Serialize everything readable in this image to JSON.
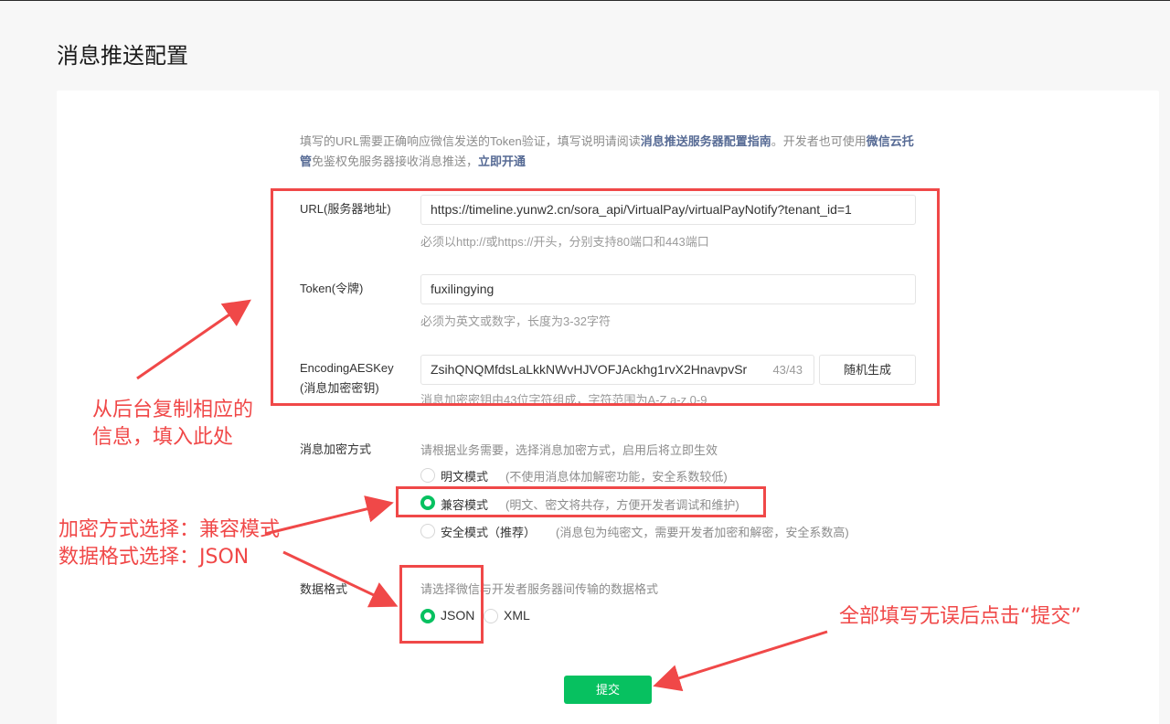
{
  "page_title": "消息推送配置",
  "intro": {
    "text1": "填写的URL需要正确响应微信发送的Token验证，填写说明请阅读",
    "link1": "消息推送服务器配置指南",
    "text2": "。开发者也可使用",
    "link2": "微信云托管",
    "text3": "免鉴权免服务器接收消息推送，",
    "link3": "立即开通"
  },
  "url_field": {
    "label": "URL(服务器地址)",
    "value": "https://timeline.yunw2.cn/sora_api/VirtualPay/virtualPayNotify?tenant_id=1",
    "help": "必须以http://或https://开头，分别支持80端口和443端口"
  },
  "token_field": {
    "label": "Token(令牌)",
    "value": "fuxilingying",
    "help": "必须为英文或数字，长度为3-32字符"
  },
  "aes_field": {
    "label_line1": "EncodingAESKey",
    "label_line2": "(消息加密密钥)",
    "value": "ZsihQNQMfdsLaLkkNWvHJVOFJAckhg1rvX2HnavpvSr",
    "counter": "43/43",
    "generate_label": "随机生成",
    "help": "消息加密密钥由43位字符组成，字符范围为A-Z,a-z,0-9"
  },
  "encryption": {
    "label": "消息加密方式",
    "hint": "请根据业务需要，选择消息加密方式，启用后将立即生效",
    "options": [
      {
        "label": "明文模式",
        "desc": "(不使用消息体加解密功能，安全系数较低)",
        "selected": false
      },
      {
        "label": "兼容模式",
        "desc": "(明文、密文将共存，方便开发者调试和维护)",
        "selected": true
      },
      {
        "label": "安全模式（推荐）",
        "desc": "(消息包为纯密文，需要开发者加密和解密，安全系数高)",
        "selected": false
      }
    ]
  },
  "data_format": {
    "label": "数据格式",
    "hint": "请选择微信与开发者服务器间传输的数据格式",
    "options": [
      {
        "label": "JSON",
        "selected": true
      },
      {
        "label": "XML",
        "selected": false
      }
    ]
  },
  "submit_label": "提交",
  "annotations": {
    "copy_line1": "从后台复制相应的",
    "copy_line2": "信息，填入此处",
    "mode_line1": "加密方式选择：兼容模式",
    "mode_line2": "数据格式选择：JSON",
    "submit_note": "全部填写无误后点击“提交”"
  },
  "colors": {
    "accent_green": "#07c160",
    "link": "#576b95",
    "annotation_red": "#f04848"
  }
}
